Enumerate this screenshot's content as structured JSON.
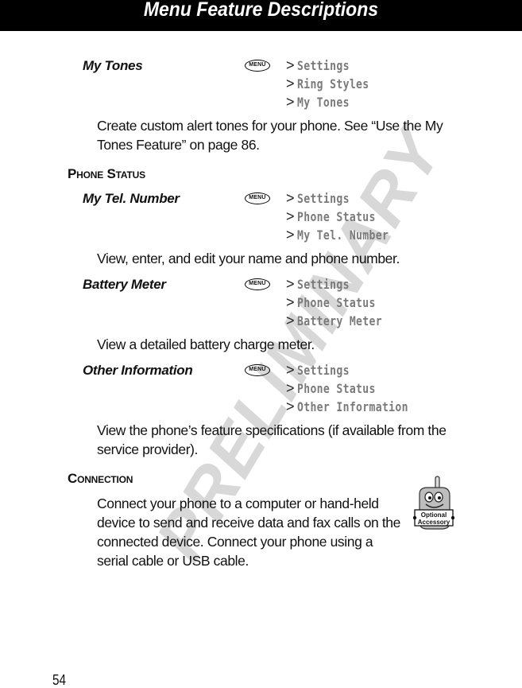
{
  "header": {
    "title": "Menu Feature Descriptions"
  },
  "watermark": "PRELIMINARY",
  "menu_key_label": "MENU",
  "path_separator": ">",
  "features": [
    {
      "name": "My Tones",
      "path": [
        "Settings",
        "Ring Styles",
        "My Tones"
      ],
      "description": "Create custom alert tones for your phone. See “Use the My Tones Feature” on page 86."
    }
  ],
  "sections": [
    {
      "heading": "Phone Status",
      "features": [
        {
          "name": "My Tel. Number",
          "path": [
            "Settings",
            "Phone Status",
            "My Tel. Number"
          ],
          "description": "View, enter, and edit your name and phone number."
        },
        {
          "name": "Battery Meter",
          "path": [
            "Settings",
            "Phone Status",
            "Battery Meter"
          ],
          "description": "View a detailed battery charge meter."
        },
        {
          "name": "Other Information",
          "path": [
            "Settings",
            "Phone Status",
            "Other Information"
          ],
          "description": "View the phone’s feature specifications (if available from the service provider)."
        }
      ]
    },
    {
      "heading": "Connection",
      "description": "Connect your phone to a computer or hand-held device to send and receive data and fax calls on the connected device. Connect your phone using a serial cable or USB cable.",
      "badge": {
        "icon": "optional-accessory-icon",
        "line1": "Optional",
        "line2": "Accessory"
      }
    }
  ],
  "page_number": "54"
}
